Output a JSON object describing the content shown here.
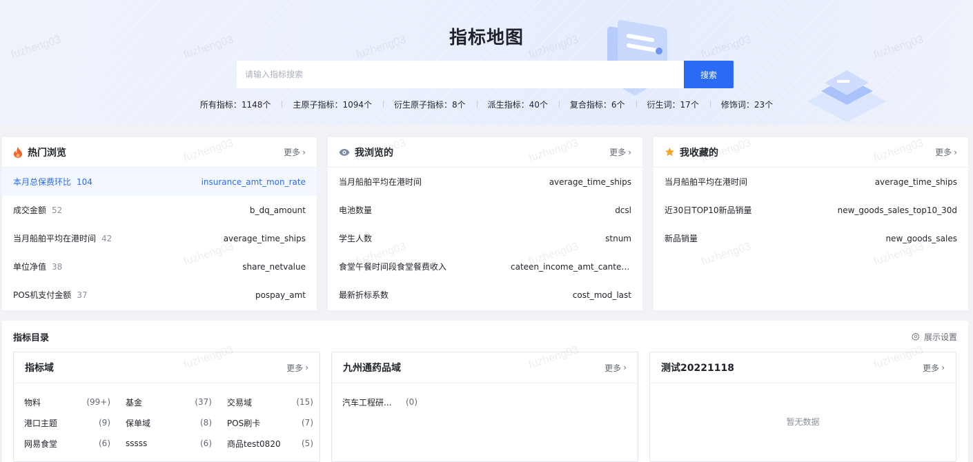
{
  "header": {
    "title": "指标地图",
    "search_placeholder": "请输入指标搜索",
    "search_button": "搜索",
    "stats": [
      "所有指标：1148个",
      "主原子指标：1094个",
      "衍生原子指标：8个",
      "派生指标：40个",
      "复合指标：6个",
      "衍生词：17个",
      "修饰词：23个"
    ]
  },
  "hot": {
    "title": "热门浏览",
    "more": "更多",
    "items": [
      {
        "name": "本月总保费环比",
        "count": "104",
        "code": "insurance_amt_mon_rate"
      },
      {
        "name": "成交金额",
        "count": "52",
        "code": "b_dq_amount"
      },
      {
        "name": "当月船舶平均在港时间",
        "count": "42",
        "code": "average_time_ships"
      },
      {
        "name": "单位净值",
        "count": "38",
        "code": "share_netvalue"
      },
      {
        "name": "POS机支付金额",
        "count": "37",
        "code": "pospay_amt"
      }
    ]
  },
  "viewed": {
    "title": "我浏览的",
    "more": "更多",
    "items": [
      {
        "name": "当月船舶平均在港时间",
        "code": "average_time_ships"
      },
      {
        "name": "电池数量",
        "code": "dcsl"
      },
      {
        "name": "学生人数",
        "code": "stnum"
      },
      {
        "name": "食堂午餐时间段食堂餐费收入",
        "code": "cateen_income_amt_cantee..."
      },
      {
        "name": "最新折标系数",
        "code": "cost_mod_last"
      }
    ]
  },
  "favorites": {
    "title": "我收藏的",
    "more": "更多",
    "items": [
      {
        "name": "当月船舶平均在港时间",
        "code": "average_time_ships"
      },
      {
        "name": "近30日TOP10新品销量",
        "code": "new_goods_sales_top10_30d"
      },
      {
        "name": "新品销量",
        "code": "new_goods_sales"
      }
    ]
  },
  "catalog": {
    "title": "指标目录",
    "settings": "展示设置",
    "domains": [
      {
        "title": "指标域",
        "more": "更多",
        "items": [
          {
            "name": "物料",
            "num": "(99+)"
          },
          {
            "name": "基金",
            "num": "(37)"
          },
          {
            "name": "交易域",
            "num": "(15)"
          },
          {
            "name": "港口主题",
            "num": "(9)"
          },
          {
            "name": "保单域",
            "num": "(8)"
          },
          {
            "name": "POS刷卡",
            "num": "(7)"
          },
          {
            "name": "网易食堂",
            "num": "(6)"
          },
          {
            "name": "sssss",
            "num": "(6)"
          },
          {
            "name": "商品test0820",
            "num": "(5)"
          }
        ]
      },
      {
        "title": "九州通药品域",
        "more": "更多",
        "items": [
          {
            "name": "汽车工程研...",
            "num": "(0)"
          }
        ]
      },
      {
        "title": "测试20221118",
        "more": "更多",
        "empty": "暂无数据"
      }
    ]
  },
  "watermark": "fuzheng03",
  "colors": {
    "accent": "#2b6bf3",
    "fire": "#f2642a",
    "star": "#f5a623"
  }
}
